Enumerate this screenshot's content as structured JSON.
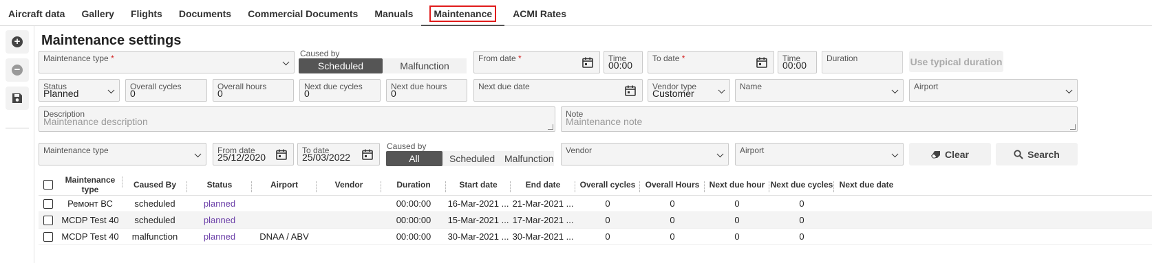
{
  "tabs": [
    "Aircraft data",
    "Gallery",
    "Flights",
    "Documents",
    "Commercial Documents",
    "Manuals",
    "Maintenance",
    "ACMI Rates"
  ],
  "page_title": "Maintenance settings",
  "form": {
    "maintenance_type_label": "Maintenance type",
    "caused_by_label": "Caused by",
    "caused_by_options": [
      "Scheduled",
      "Malfunction"
    ],
    "from_date_label": "From date",
    "time_label": "Time",
    "from_time": "00:00",
    "to_date_label": "To date",
    "to_time": "00:00",
    "duration_label": "Duration",
    "use_typical_label": "Use typical duration",
    "status_label": "Status",
    "status_value": "Planned",
    "overall_cycles_label": "Overall cycles",
    "overall_cycles_value": "0",
    "overall_hours_label": "Overall hours",
    "overall_hours_value": "0",
    "next_due_cycles_label": "Next due cycles",
    "next_due_cycles_value": "0",
    "next_due_hours_label": "Next due hours",
    "next_due_hours_value": "0",
    "next_due_date_label": "Next due date",
    "vendor_type_label": "Vendor type",
    "vendor_type_value": "Customer",
    "name_label": "Name",
    "airport_label": "Airport",
    "description_label": "Description",
    "description_placeholder": "Maintenance description",
    "note_label": "Note",
    "note_placeholder": "Maintenance note"
  },
  "filter": {
    "maintenance_type_label": "Maintenance type",
    "from_date_label": "From date",
    "from_date_value": "25/12/2020",
    "to_date_label": "To date",
    "to_date_value": "25/03/2022",
    "caused_by_label": "Caused by",
    "caused_by_options": [
      "All",
      "Scheduled",
      "Malfunction"
    ],
    "vendor_label": "Vendor",
    "airport_label": "Airport",
    "clear_label": "Clear",
    "search_label": "Search"
  },
  "table": {
    "columns": [
      "Maintenance type",
      "Caused By",
      "Status",
      "Airport",
      "Vendor",
      "Duration",
      "Start date",
      "End date",
      "Overall cycles",
      "Overall Hours",
      "Next due hour",
      "Next due cycles",
      "Next due date"
    ],
    "rows": [
      [
        "Ремонт ВС",
        "scheduled",
        "planned",
        "",
        "",
        "00:00:00",
        "16-Mar-2021 ...",
        "21-Mar-2021 ...",
        "0",
        "0",
        "0",
        "0",
        ""
      ],
      [
        "MCDP Test 40",
        "scheduled",
        "planned",
        "",
        "",
        "00:00:00",
        "15-Mar-2021 ...",
        "17-Mar-2021 ...",
        "0",
        "0",
        "0",
        "0",
        ""
      ],
      [
        "MCDP Test 40",
        "malfunction",
        "planned",
        "DNAA / ABV",
        "",
        "00:00:00",
        "30-Mar-2021 ...",
        "30-Mar-2021 ...",
        "0",
        "0",
        "0",
        "0",
        ""
      ]
    ]
  },
  "colors": {
    "accent_tab_outline": "#e01b1b",
    "status_text": "#6b3fa8",
    "toggle_active": "#555555"
  },
  "icons": [
    "add-circle-icon",
    "remove-circle-icon",
    "save-icon",
    "calendar-icon",
    "eraser-icon",
    "search-icon",
    "chevron-down-icon"
  ]
}
